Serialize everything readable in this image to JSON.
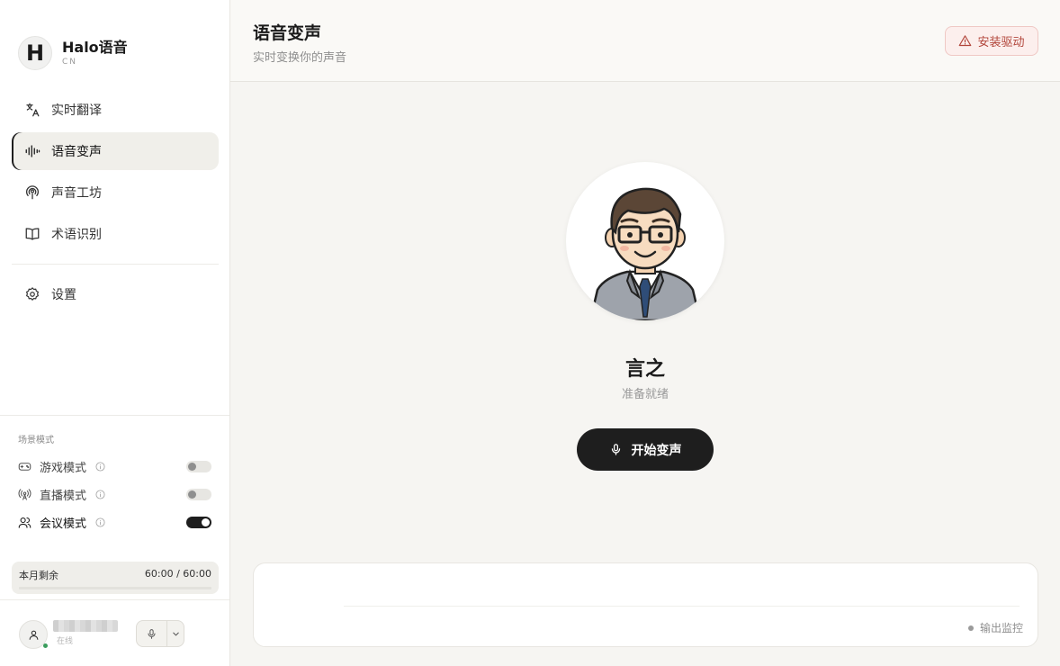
{
  "brand": {
    "logo_letter": "H",
    "name": "Halo语音",
    "sub": "CN"
  },
  "nav": {
    "items": [
      {
        "label": "实时翻译",
        "icon": "translate-icon",
        "active": false
      },
      {
        "label": "语音变声",
        "icon": "waveform-icon",
        "active": true
      },
      {
        "label": "声音工坊",
        "icon": "podcast-icon",
        "active": false
      },
      {
        "label": "术语识别",
        "icon": "book-icon",
        "active": false
      }
    ],
    "settings": {
      "label": "设置",
      "icon": "gear-icon"
    }
  },
  "scene": {
    "title": "场景模式",
    "modes": [
      {
        "label": "游戏模式",
        "icon": "gamepad-icon",
        "enabled": false
      },
      {
        "label": "直播模式",
        "icon": "broadcast-icon",
        "enabled": false
      },
      {
        "label": "会议模式",
        "icon": "users-icon",
        "enabled": true
      }
    ]
  },
  "quota": {
    "label": "本月剩余",
    "value": "60:00 / 60:00",
    "fraction": 1.0
  },
  "user": {
    "name": "",
    "status": "在线"
  },
  "header": {
    "title": "语音变声",
    "subtitle": "实时变换你的声音",
    "driver_button": "安装驱动"
  },
  "character": {
    "name": "言之",
    "status": "准备就绪"
  },
  "start_button": {
    "label": "开始变声"
  },
  "monitor": {
    "label": "输出监控"
  },
  "colors": {
    "accent": "#1e1e1e",
    "warning": "#b2463b",
    "online": "#3a9d5d"
  }
}
